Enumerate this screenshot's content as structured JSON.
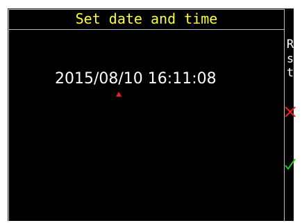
{
  "title": "Set date and time",
  "datetime": {
    "value": "2015/08/10 16:11:08",
    "cursor_field": "day"
  },
  "softkeys": {
    "reset": [
      "R",
      "s",
      "t"
    ],
    "cancel_icon": "cross-icon",
    "confirm_icon": "checkmark-icon"
  },
  "colors": {
    "title": "#ffff33",
    "text": "#ffffff",
    "background": "#000000",
    "cursor": "#ff1a1a",
    "cancel": "#ff1a1a",
    "confirm": "#22cc22"
  }
}
